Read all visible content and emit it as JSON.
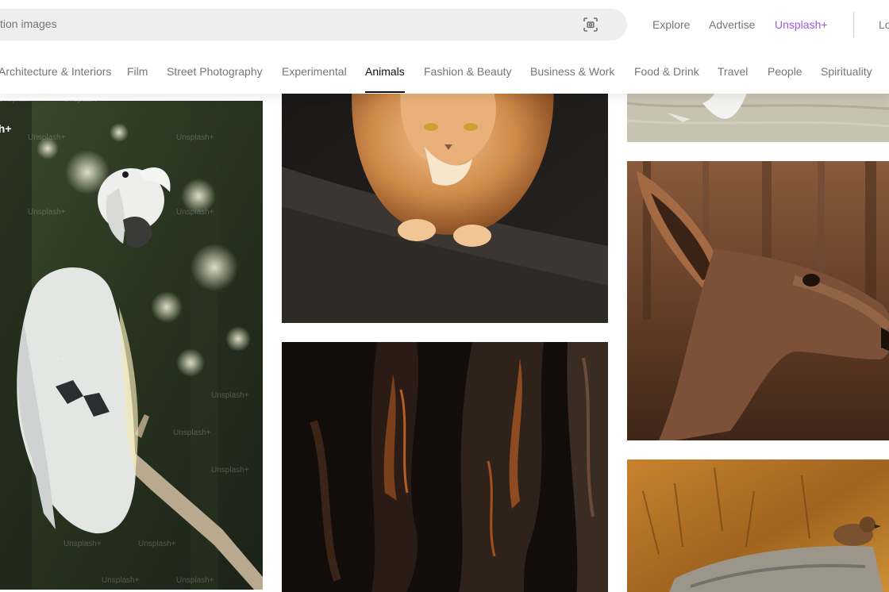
{
  "header": {
    "search": {
      "visible_text": "tion images",
      "placeholder": "Search high-resolution images"
    },
    "nav": {
      "explore": "Explore",
      "advertise": "Advertise",
      "unsplash_plus": "Unsplash+",
      "login_partial": "Lo"
    },
    "icons": {
      "visual_search": "visual-search-icon"
    }
  },
  "topics": {
    "items": [
      "Architecture & Interiors",
      "Film",
      "Street Photography",
      "Experimental",
      "Animals",
      "Fashion & Beauty",
      "Business & Work",
      "Food & Drink",
      "Travel",
      "People",
      "Spirituality"
    ],
    "active": "Animals"
  },
  "photos": [
    {
      "subject": "white cockatoo on branch",
      "badge": "Unsplash+",
      "badge_visible": "sh+"
    },
    {
      "subject": "fluffy orange cat"
    },
    {
      "subject": "dark tree bark"
    },
    {
      "subject": "swan on water"
    },
    {
      "subject": "deer head in profile"
    },
    {
      "subject": "sparrow on tree stump"
    }
  ],
  "watermark": "Unsplash+",
  "colors": {
    "accent_plus": "#a05bdc",
    "text_muted": "#767676",
    "text_active": "#111111",
    "search_bg": "#eeeeee"
  }
}
